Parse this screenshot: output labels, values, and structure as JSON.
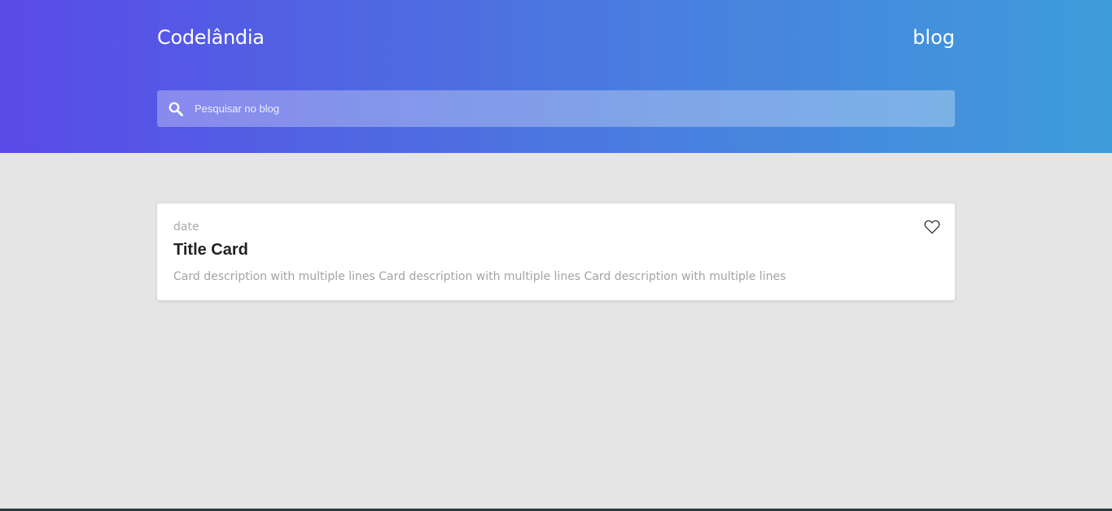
{
  "header": {
    "brand": "Codelândia",
    "nav_link": "blog",
    "gradient_start": "#5a4ae8",
    "gradient_end": "#3f9cdb"
  },
  "search": {
    "placeholder": "Pesquisar no blog",
    "value": "",
    "icon": "search-icon"
  },
  "cards": [
    {
      "date": "date",
      "title": "Title Card",
      "description": "Card description with multiple lines Card description with multiple lines Card description with multiple lines",
      "icon": "heart-outline-icon"
    }
  ],
  "colors": {
    "background": "#e5e5e5",
    "card_bg": "#ffffff",
    "title": "#222222",
    "muted_text": "#a3a3a3"
  }
}
